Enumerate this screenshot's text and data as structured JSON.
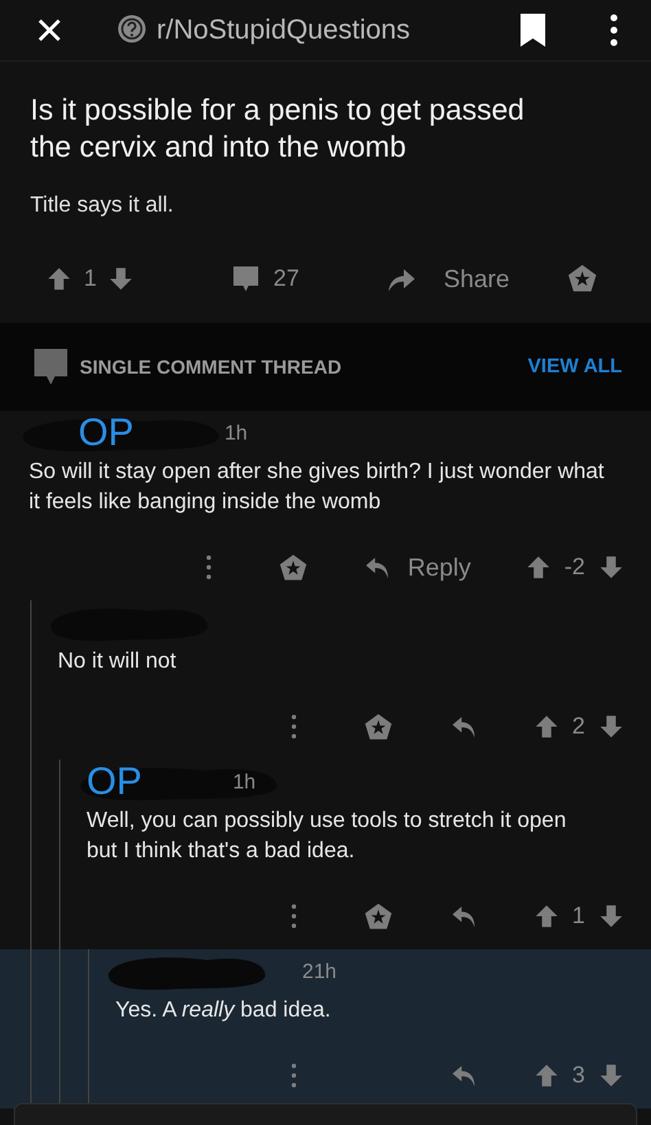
{
  "header": {
    "subreddit": "r/NoStupidQuestions"
  },
  "post": {
    "title": "Is it possible for a penis to get passed the cervix and into the womb",
    "body": "Title says it all.",
    "score": "1",
    "comments": "27",
    "share_label": "Share"
  },
  "thread_bar": {
    "label": "SINGLE COMMENT THREAD",
    "action": "VIEW ALL"
  },
  "comments": [
    {
      "op_badge": "OP",
      "time": "1h",
      "body": "So will it stay open after she gives birth? I just wonder what it feels like banging inside the womb",
      "award": true,
      "reply_label": "Reply",
      "score": "-2",
      "highlighted": false,
      "children": [
        {
          "body": "No it will not",
          "award": true,
          "score": "2",
          "highlighted": false,
          "children": [
            {
              "op_badge": "OP",
              "time": "1h",
              "body": "Well, you can possibly use tools to stretch it open but I think that's a bad idea.",
              "award": true,
              "score": "1",
              "highlighted": false,
              "children": [
                {
                  "time": "21h",
                  "body": "Yes. A *really* bad idea.",
                  "award": false,
                  "score": "3",
                  "highlighted": true
                }
              ]
            }
          ]
        }
      ]
    }
  ]
}
